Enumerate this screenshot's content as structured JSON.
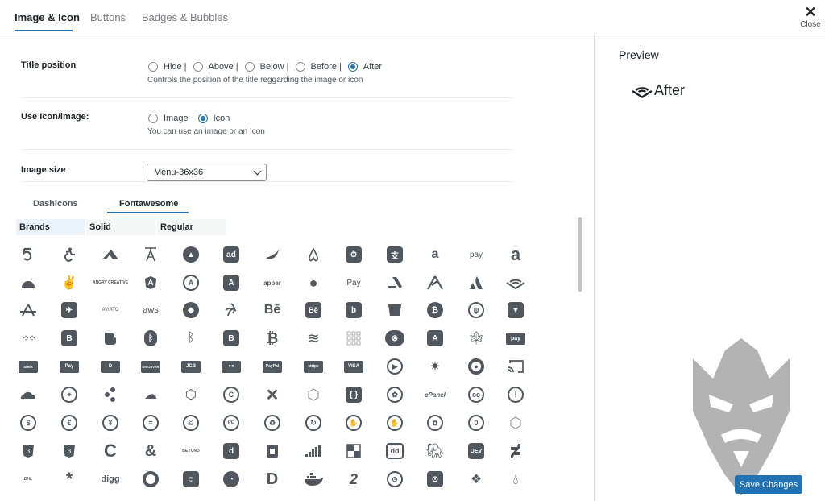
{
  "tabs": [
    "Image & Icon",
    "Buttons",
    "Badges & Bubbles"
  ],
  "close_label": "Close",
  "title_position": {
    "label": "Title position",
    "options": [
      "Hide |",
      "Above |",
      "Below |",
      "Before |",
      "After"
    ],
    "selected": "After",
    "help": "Controls the position of the title reggarding the image or icon"
  },
  "use_icon": {
    "label": "Use Icon/image:",
    "options": [
      "Image",
      "Icon"
    ],
    "selected": "Icon",
    "help": "You can use an image or an Icon"
  },
  "image_size": {
    "label": "Image size",
    "value": "Menu-36x36"
  },
  "icon_sources": [
    "Dashicons",
    "Fontawesome"
  ],
  "icon_sources_active": "Fontawesome",
  "icon_categories": [
    "Brands",
    "Solid",
    "Regular"
  ],
  "icon_categories_active": "Brands",
  "icon_text": {
    "ad": "ad",
    "pay": "pay",
    "angry": "ANGRY CREATIVE",
    "apper": "apper",
    "applepay": "Pay",
    "aviato": "AVIATO",
    "aws": "aws",
    "behance": "Bē",
    "behance_sq": "Bē",
    "bootstrap": "B",
    "amex": "AMEX",
    "applepay_card": "Pay",
    "diners": "D",
    "discover": "DISCOVER",
    "jcb": "JCB",
    "paypal": "PayPal",
    "stripe": "stripe",
    "visa": "VISA",
    "cpanel": "cPanel",
    "cc": "cc",
    "pd": "PD",
    "beyond": "BEYOND",
    "dd": "dd",
    "dev": "DEV",
    "dhl": "DHL",
    "digg": "digg",
    "css3_1": "3",
    "css3_2": "3"
  },
  "preview": {
    "title": "Preview",
    "item_label": "After"
  },
  "save_label": "Save Changes"
}
